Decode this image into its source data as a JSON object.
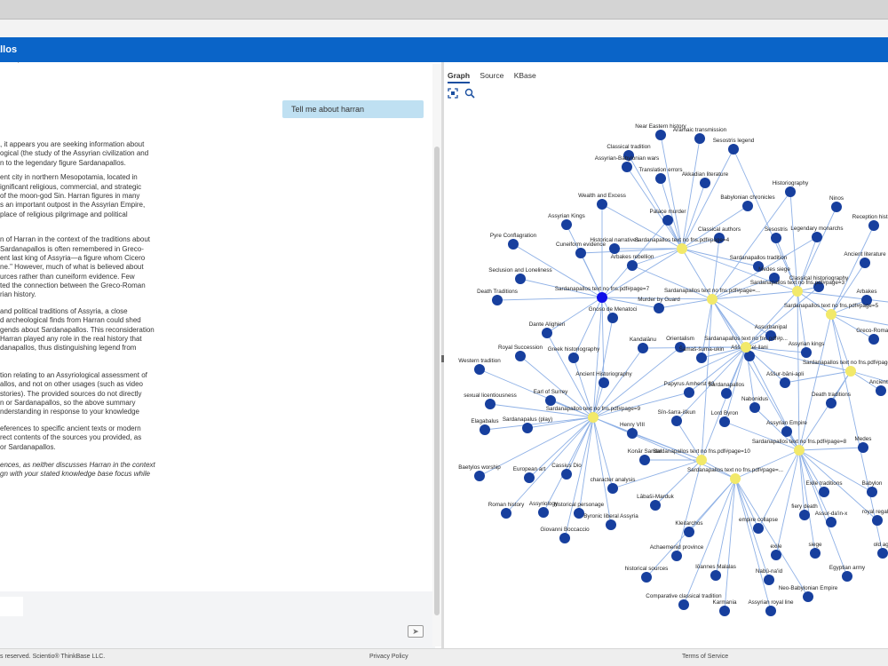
{
  "header": {
    "title": "allos"
  },
  "chat": {
    "user_message": "Tell me about harran",
    "top_fragment": "'",
    "answer_lines": [
      [
        ", it appears you are seeking information about",
        "ogical (the study of the Assyrian civilization and",
        "n to the legendary figure Sardanapallos."
      ],
      [
        "ent city in northern Mesopotamia, located in",
        "ignificant religious, commercial, and strategic",
        "of the moon-god Sin. Harran figures in many",
        "s an important outpost in the Assyrian Empire,",
        "place of religious pilgrimage and political"
      ],
      [
        "n of Harran in the context of the traditions about",
        "Sardanapallos is often remembered in Greco-",
        "ent last king of Assyria—a figure whom Cicero",
        "ne.\" However, much of what is believed about",
        "urces rather than cuneiform evidence. Few",
        "ted the connection between the Greco-Roman",
        "rian history."
      ],
      [
        "and political traditions of Assyria, a close",
        "d archeological finds from Harran could shed",
        "gends about Sardanapallos. This reconsideration",
        "Harran played any role in the real history that",
        "danapallos, thus distinguishing legend from"
      ],
      [
        "tion relating to an Assyriological assessment of",
        "allos, and not on other usages (such as video",
        "stories). The provided sources do not directly",
        "n or Sardanapallos, so the above summary",
        "nderstanding in response to your knowledge"
      ],
      [
        "eferences to specific ancient texts or modern",
        "rect contents of the sources you provided, as",
        "or Sardanapallos."
      ]
    ],
    "answer_italic": [
      "ences, as neither discusses Harran in the context",
      "gn with your stated knowledge base focus while"
    ],
    "input_value": "",
    "send_icon": "send-icon"
  },
  "graph_panel": {
    "tabs": [
      {
        "label": "Graph",
        "active": true
      },
      {
        "label": "Source",
        "active": false
      },
      {
        "label": "KBase",
        "active": false
      }
    ],
    "tools": [
      "fit-screen-icon",
      "search-icon"
    ]
  },
  "colors": {
    "header": "#0a64c8",
    "node": "#173f9e",
    "hub": "#f2e96a",
    "selected": "#1010e8",
    "edge": "#8fb1e6",
    "bubble": "#bfe0f2"
  },
  "footer": {
    "copyright": "s reserved. Scientio® ThinkBase LLC.",
    "privacy": "Privacy Policy",
    "terms": "Terms of Service"
  },
  "graph": {
    "hubs": [
      {
        "id": "H4",
        "label": "Sardanapallos text no fns.pdf#page=4"
      },
      {
        "id": "H7",
        "label": "Sardanapallos text no fns.pdf#page=7",
        "selected": true
      },
      {
        "id": "HA",
        "label": "Sardanapallos text no fns.pdf#page=..."
      },
      {
        "id": "H3",
        "label": "Sardanapallos text no fns.pdf#page=3"
      },
      {
        "id": "H5",
        "label": "Sardanapallos text no fns.pdf#page=5"
      },
      {
        "id": "HB",
        "label": "Sardanapallos text no fns.pdf#p..."
      },
      {
        "id": "HC",
        "label": "Sardanapallos text no fns.pdf#page=..."
      },
      {
        "id": "H9",
        "label": "Sardanapallos text no fns.pdf#page=9"
      },
      {
        "id": "H10",
        "label": "Sardanapallos text no fns.pdf#page=10"
      },
      {
        "id": "H8",
        "label": "Sardanapallos text no fns.pdf#page=8"
      },
      {
        "id": "HD",
        "label": "Sardanapallos text no fns.pdf#page=..."
      }
    ],
    "nodes": [
      {
        "label": "Near Eastern history"
      },
      {
        "label": "Aramaic transmission"
      },
      {
        "label": "Sesostris legend"
      },
      {
        "label": "Classical tradition"
      },
      {
        "label": "Assyrian-Babylonian wars"
      },
      {
        "label": "Translation errors"
      },
      {
        "label": "Akkadian literature"
      },
      {
        "label": "Historiography"
      },
      {
        "label": "Wealth and Excess"
      },
      {
        "label": "Babylonian chronicles"
      },
      {
        "label": "Ninos"
      },
      {
        "label": "Assyrian Kings"
      },
      {
        "label": "Palace murder"
      },
      {
        "label": "Reception history"
      },
      {
        "label": "Classical authors"
      },
      {
        "label": "Sesostris"
      },
      {
        "label": "Legendary monarchs"
      },
      {
        "label": "Pyre Conflagration"
      },
      {
        "label": "Historical narratives"
      },
      {
        "label": "Ancient literature"
      },
      {
        "label": "Cuneiform evidence"
      },
      {
        "label": "Sardanapallos tradition"
      },
      {
        "label": "Arbakes rebellion"
      },
      {
        "label": "Medes siege"
      },
      {
        "label": "Seclusion and Loneliness"
      },
      {
        "label": "Classical historiography"
      },
      {
        "label": "Arbakes"
      },
      {
        "label": "Death Traditions"
      },
      {
        "label": "Murder by Guard"
      },
      {
        "label": "Gnoso de Menatoci"
      },
      {
        "label": "Dante Alighieri"
      },
      {
        "label": "Assurbanipal"
      },
      {
        "label": "Greco-Roman"
      },
      {
        "label": "Orientalism"
      },
      {
        "label": "Assyrian kings"
      },
      {
        "label": "Royal Succession"
      },
      {
        "label": "Greek historiography"
      },
      {
        "label": "Kandalānu"
      },
      {
        "label": "Aššur-etel-ilani"
      },
      {
        "label": "Western tradition"
      },
      {
        "label": "Šamaš-šuma-ukin"
      },
      {
        "label": "Aššur-bāni-apli"
      },
      {
        "label": "Ancient Historiography"
      },
      {
        "label": "Earl of Surrey"
      },
      {
        "label": "Papyrus Amherst 63"
      },
      {
        "label": "Sardanapallos"
      },
      {
        "label": "Ancient..."
      },
      {
        "label": "sexual licentiousness"
      },
      {
        "label": "Nabonidus"
      },
      {
        "label": "Death traditions"
      },
      {
        "label": "Sîn-šarra-iškun"
      },
      {
        "label": "Lord Byron"
      },
      {
        "label": "Henry VIII"
      },
      {
        "label": "Assyrian Empire"
      },
      {
        "label": "Elagabalus"
      },
      {
        "label": "Sardanapalus (play)"
      },
      {
        "label": "Medes"
      },
      {
        "label": "Konār Sandal"
      },
      {
        "label": "Baetylos worship"
      },
      {
        "label": "European art"
      },
      {
        "label": "Cassius Dio"
      },
      {
        "label": "character analysis"
      },
      {
        "label": "Exile traditions"
      },
      {
        "label": "Babylon"
      },
      {
        "label": "Lābaši-Marduk"
      },
      {
        "label": "Roman history"
      },
      {
        "label": "Assyriology"
      },
      {
        "label": "historical personage"
      },
      {
        "label": "fiery death"
      },
      {
        "label": "Assur-da'in-x"
      },
      {
        "label": "royal regalia"
      },
      {
        "label": "Byronic liberal Assyria"
      },
      {
        "label": "Kleitarchos"
      },
      {
        "label": "empire collapse"
      },
      {
        "label": "Giovanni Boccaccio"
      },
      {
        "label": "Achaemenid province"
      },
      {
        "label": "exile"
      },
      {
        "label": "siege"
      },
      {
        "label": "old age"
      },
      {
        "label": "historical sources"
      },
      {
        "label": "Iōannes Malalas"
      },
      {
        "label": "Nabû-na'id"
      },
      {
        "label": "Egyptian army"
      },
      {
        "label": "Neo-Babylonian Empire"
      },
      {
        "label": "Comparative classical tradition"
      },
      {
        "label": "Karmania"
      },
      {
        "label": "Assyrian royal line"
      }
    ]
  }
}
